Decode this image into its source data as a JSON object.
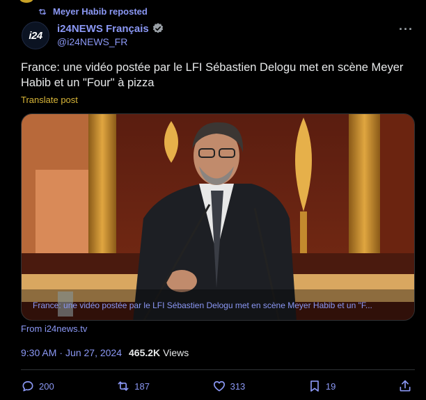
{
  "repost": {
    "text": "Meyer Habib reposted",
    "icon": "repost-icon"
  },
  "author": {
    "avatar_text": "i24",
    "name": "i24NEWS Français",
    "handle": "@i24NEWS_FR",
    "verified_icon": "verified-badge-icon"
  },
  "more_label": "···",
  "post": {
    "text": "France: une vidéo postée par le LFI Sébastien Delogu met en scène Meyer Habib et un \"Four\" à pizza",
    "translate": "Translate post"
  },
  "media": {
    "caption": "France: une vidéo postée par le LFI Sébastien Delogu met en scène Meyer Habib et un \"F..."
  },
  "source": "From i24news.tv",
  "meta": {
    "time": "9:30 AM",
    "separator": "·",
    "date": "Jun 27, 2024",
    "views_count": "465.2K",
    "views_label": "Views"
  },
  "actions": {
    "replies": "200",
    "reposts": "187",
    "likes": "313",
    "bookmarks": "19"
  },
  "colors": {
    "background": "#000000",
    "accent": "#8b98f5",
    "text": "#e7e9ea",
    "translate": "#d9b638"
  }
}
